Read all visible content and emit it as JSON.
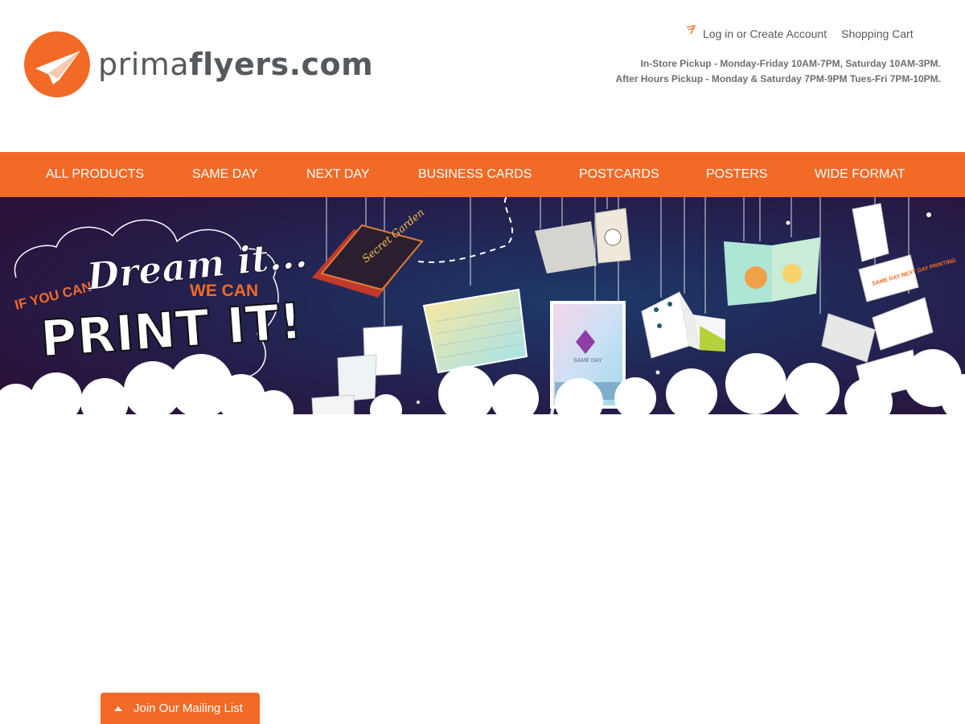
{
  "brand": {
    "logo_light": "prima",
    "logo_bold": "flyers",
    "logo_suffix": ".com",
    "color": "#f26a26"
  },
  "account": {
    "icon": "user-icon",
    "login_label": "Log in or Create Account",
    "cart_label": "Shopping Cart"
  },
  "hours": {
    "line1": "In-Store Pickup - Monday-Friday 10AM-7PM, Saturday 10AM-3PM.",
    "line2": "After Hours Pickup - Monday & Saturday 7PM-9PM Tues-Fri 7PM-10PM."
  },
  "nav": {
    "items": [
      {
        "label": "ALL PRODUCTS"
      },
      {
        "label": "SAME DAY"
      },
      {
        "label": "NEXT DAY"
      },
      {
        "label": "BUSINESS CARDS"
      },
      {
        "label": "POSTCARDS"
      },
      {
        "label": "POSTERS"
      },
      {
        "label": "WIDE FORMAT"
      }
    ]
  },
  "banner": {
    "line1": "IF YOU CAN",
    "line2": "Dream it...",
    "line3": "WE CAN",
    "line4": "PRINT IT!",
    "flyer_text": "Secret Garden",
    "poster_text": "SAME DAY",
    "card_text": "SAME DAY NEXT DAY PRINTING",
    "background": "#231a45"
  },
  "mailing": {
    "label": "Join Our Mailing List",
    "icon": "caret-up-icon"
  }
}
